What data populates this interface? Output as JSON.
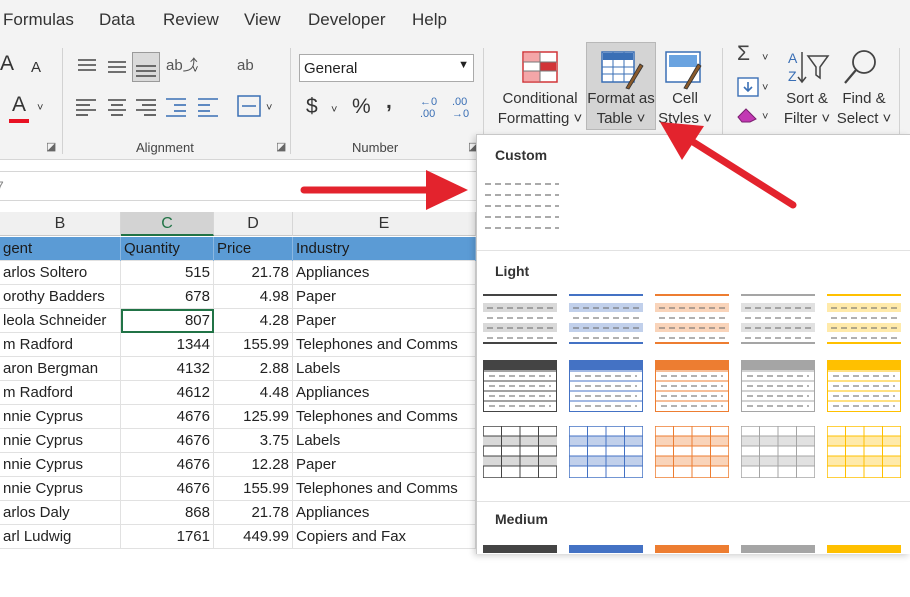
{
  "menu_tabs": [
    "Formulas",
    "Data",
    "Review",
    "View",
    "Developer",
    "Help"
  ],
  "ribbon": {
    "number_format_value": "General",
    "groups": {
      "alignment": "Alignment",
      "number": "Number"
    },
    "buttons": {
      "conditional_formatting": [
        "Conditional",
        "Formatting ˅"
      ],
      "format_as_table": [
        "Format as",
        "Table ˅"
      ],
      "cell_styles": [
        "Cell",
        "Styles ˅"
      ],
      "sort_filter": [
        "Sort &",
        "Filter ˅"
      ],
      "find_select": [
        "Find &",
        "Select ˅"
      ]
    },
    "glyphs": {
      "font_a_large": "A",
      "font_a_small": "A",
      "font_color_a": "A",
      "currency": "$",
      "percent": "%",
      "comma": ",",
      "sum": "Σ",
      "wrap": "ab",
      "dec_increase": ".00",
      "dec_decrease": ".00"
    },
    "colors": {
      "font_color_bar": "#e81123",
      "accent": "#217346"
    }
  },
  "name_box_fragment": "7",
  "grid": {
    "columns": [
      "B",
      "C",
      "D",
      "E"
    ],
    "selected_column": "C",
    "header_row": [
      "gent",
      "Quantity",
      "Price",
      "Industry"
    ],
    "rows": [
      [
        "arlos Soltero",
        "515",
        "21.78",
        "Appliances"
      ],
      [
        "orothy Badders",
        "678",
        "4.98",
        "Paper"
      ],
      [
        "leola Schneider",
        "807",
        "4.28",
        "Paper"
      ],
      [
        "m Radford",
        "1344",
        "155.99",
        "Telephones and Comms"
      ],
      [
        "aron Bergman",
        "4132",
        "2.88",
        "Labels"
      ],
      [
        "m Radford",
        "4612",
        "4.48",
        "Appliances"
      ],
      [
        "nnie Cyprus",
        "4676",
        "125.99",
        "Telephones and Comms"
      ],
      [
        "nnie Cyprus",
        "4676",
        "3.75",
        "Labels"
      ],
      [
        "nnie Cyprus",
        "4676",
        "12.28",
        "Paper"
      ],
      [
        "nnie Cyprus",
        "4676",
        "155.99",
        "Telephones and Comms"
      ],
      [
        "arlos Daly",
        "868",
        "21.78",
        "Appliances"
      ],
      [
        "arl Ludwig",
        "1761",
        "449.99",
        "Copiers and Fax"
      ]
    ],
    "header_color": "#5b9bd5"
  },
  "dropdown": {
    "sections": [
      "Custom",
      "Light",
      "Medium"
    ],
    "style_colors": [
      "#444444",
      "#4472c4",
      "#ed7d31",
      "#a5a5a5",
      "#ffc000"
    ]
  },
  "annotations": {
    "arrow_color": "#e3232d"
  }
}
